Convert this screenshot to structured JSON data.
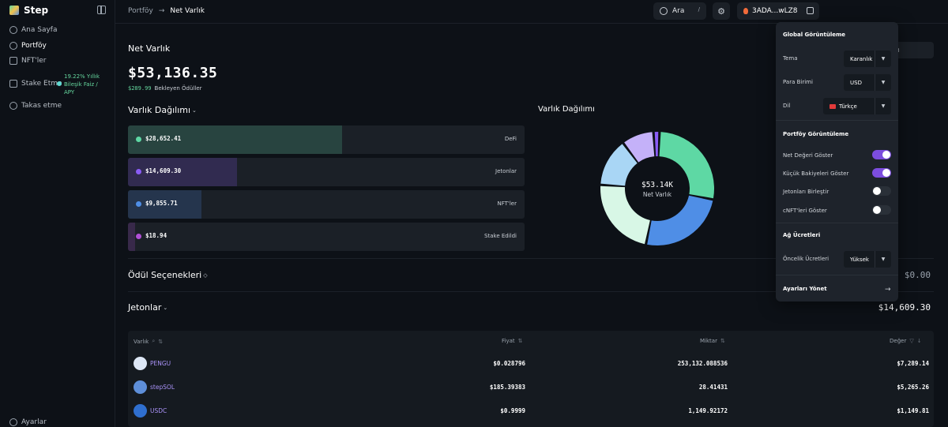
{
  "app": {
    "name": "Step"
  },
  "sidebar": {
    "items": [
      {
        "label": "Ana Sayfa"
      },
      {
        "label": "Portföy"
      },
      {
        "label": "NFT'ler"
      },
      {
        "label": "Stake Etme"
      },
      {
        "label": "Takas etme"
      }
    ],
    "stake_badge": "19.22% Yıllık Bileşik Faiz / APY",
    "settings_label": "Ayarlar"
  },
  "header": {
    "breadcrumb_root": "Portföy",
    "breadcrumb_sep": "→",
    "breadcrumb_current": "Net Varlık",
    "search_label": "Ara",
    "search_shortcut": "/",
    "wallet_label": "3ADA...wLZ8"
  },
  "main": {
    "title": "Net Varlık",
    "net_value": "$53,136.35",
    "pending_amount": "$289.99",
    "pending_label": "Bekleyen Ödüller",
    "wallet_filter": "...wLZ8",
    "distribution_title": "Varlık Dağılımı",
    "distribution": [
      {
        "value": "$28,652.41",
        "label": "DeFi",
        "share": 0.54,
        "color": "#5ed8a4"
      },
      {
        "value": "$14,609.30",
        "label": "Jetonlar",
        "share": 0.275,
        "color": "#8a5cf6"
      },
      {
        "value": "$9,855.71",
        "label": "NFT'ler",
        "share": 0.185,
        "color": "#4f8ee6"
      },
      {
        "value": "$18.94",
        "label": "Stake Edildi",
        "share": 0.017,
        "color": "#b04fd6"
      }
    ],
    "donut_title": "Varlık Dağılımı",
    "donut_center_value": "$53.14K",
    "donut_center_label": "Net Varlık",
    "rewards_title": "Ödül Seçenekleri",
    "rewards_value": "$0.00",
    "tokens_title": "Jetonlar",
    "tokens_value": "$14,609.30"
  },
  "chart_data": {
    "type": "pie",
    "categories": [
      "DeFi",
      "Jetonlar",
      "NFT'ler",
      "Stake Edildi"
    ],
    "values": [
      28652.41,
      14609.3,
      9855.71,
      18.94
    ]
  },
  "donut_segments": [
    {
      "value": 24,
      "color": "#5ed8a4"
    },
    {
      "value": 22,
      "color": "#4f8ee6"
    },
    {
      "value": 20,
      "color": "#d8f7e6"
    },
    {
      "value": 12,
      "color": "#a9d6f5"
    },
    {
      "value": 8,
      "color": "#c4b1f9"
    },
    {
      "value": 1.5,
      "color": "#8a5cf6"
    }
  ],
  "table": {
    "headers": {
      "asset": "Varlık",
      "price": "Fiyat",
      "amount": "Miktar",
      "value": "Değer"
    },
    "rows": [
      {
        "name": "PENGU",
        "price": "$0.028796",
        "amount": "253,132.088536",
        "value": "$7,289.14",
        "icon_color": "#dde7f5"
      },
      {
        "name": "stepSOL",
        "price": "$185.39383",
        "amount": "28.41431",
        "value": "$5,265.26",
        "icon_color": "#5e8fd9"
      },
      {
        "name": "USDC",
        "price": "$0.9999",
        "amount": "1,149.92172",
        "value": "$1,149.81",
        "icon_color": "#2f6fcf"
      }
    ]
  },
  "settings_panel": {
    "global_title": "Global Görüntüleme",
    "theme_label": "Tema",
    "theme_value": "Karanlık",
    "currency_label": "Para Birimi",
    "currency_value": "USD",
    "language_label": "Dil",
    "language_value": "Türkçe",
    "portfolio_title": "Portföy Görüntüleme",
    "toggles": [
      {
        "label": "Net Değeri Göster",
        "on": true
      },
      {
        "label": "Küçük Bakiyeleri Göster",
        "on": true
      },
      {
        "label": "Jetonları Birleştir",
        "on": false
      },
      {
        "label": "cNFT'leri Göster",
        "on": false
      }
    ],
    "fees_title": "Ağ Ücretleri",
    "priority_label": "Öncelik Ücretleri",
    "priority_value": "Yüksek",
    "manage_label": "Ayarları Yönet"
  }
}
